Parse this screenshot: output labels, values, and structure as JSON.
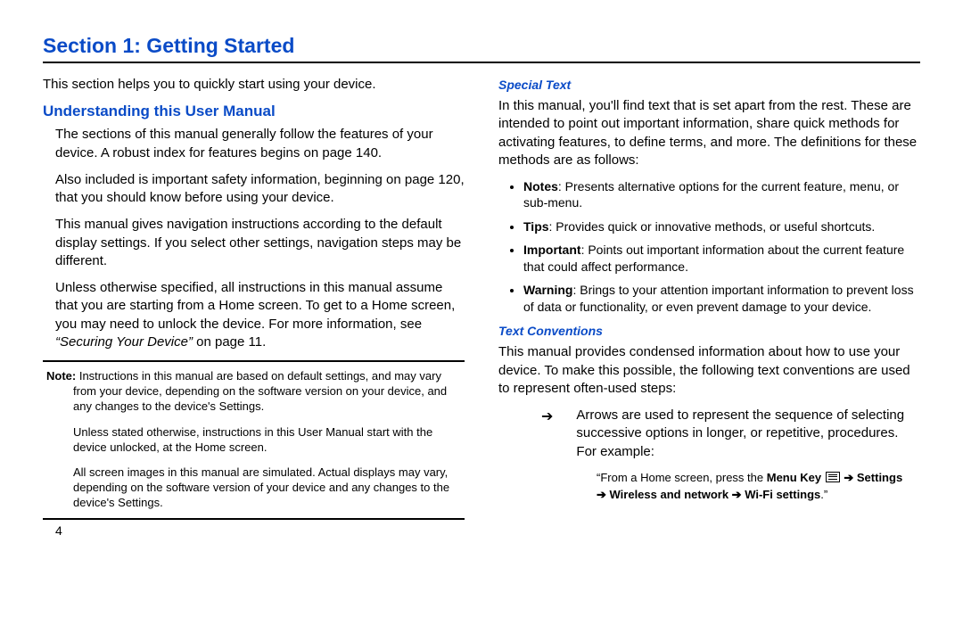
{
  "title": "Section 1: Getting Started",
  "left": {
    "intro": "This section helps you to quickly start using your device.",
    "h1": "Understanding this User Manual",
    "p1": "The sections of this manual generally follow the features of your device. A robust index for features begins on page 140.",
    "p2": "Also included is important safety information, beginning on page 120, that you should know before using your device.",
    "p3": "This manual gives navigation instructions according to the default display settings. If you select other settings, navigation steps may be different.",
    "p4a": "Unless otherwise specified, all instructions in this manual assume that you are starting from a Home screen. To get to a Home screen, you may need to unlock the device. For more information, see ",
    "p4b_italic": "“Securing Your Device”",
    "p4c": " on page 11.",
    "note": {
      "label": "Note:",
      "n1": " Instructions in this manual are based on default settings, and may vary from your device, depending on the software version on your device, and any changes to the device's Settings.",
      "n2": "Unless stated otherwise, instructions in this User Manual start with the device unlocked, at the Home screen.",
      "n3": "All screen images in this manual are simulated. Actual displays may vary, depending on the software version of your device and any changes to the device's Settings."
    },
    "pagenum": "4"
  },
  "right": {
    "h2a": "Special Text",
    "p1": "In this manual, you'll find text that is set apart from the rest. These are intended to point out important information, share quick methods for activating features, to define terms, and more. The definitions for these methods are as follows:",
    "bullets": [
      {
        "term": "Notes",
        "desc": ": Presents alternative options for the current feature, menu, or sub-menu."
      },
      {
        "term": "Tips",
        "desc": ": Provides quick or innovative methods, or useful shortcuts."
      },
      {
        "term": "Important",
        "desc": ": Points out important information about the current feature that could affect performance."
      },
      {
        "term": "Warning",
        "desc": ": Brings to your attention important information to prevent loss of data or functionality, or even prevent damage to your device."
      }
    ],
    "h2b": "Text Conventions",
    "p2": "This manual provides condensed information about how to use your device. To make this possible, the following text conventions are used to represent often-used steps:",
    "arrow_sym": "➔",
    "arrow_text": "Arrows are used to represent the sequence of selecting successive options in longer, or repetitive, procedures. For example:",
    "example": {
      "pre": "“From a Home screen, press the ",
      "menukey": "Menu Key",
      "arrow1": " ➔ ",
      "settings": "Settings",
      "line2_arrow": "➔ ",
      "wn": "Wireless and network",
      "mid_arrow": "  ➔  ",
      "wifi": "Wi-Fi settings",
      "end": ".”"
    }
  }
}
